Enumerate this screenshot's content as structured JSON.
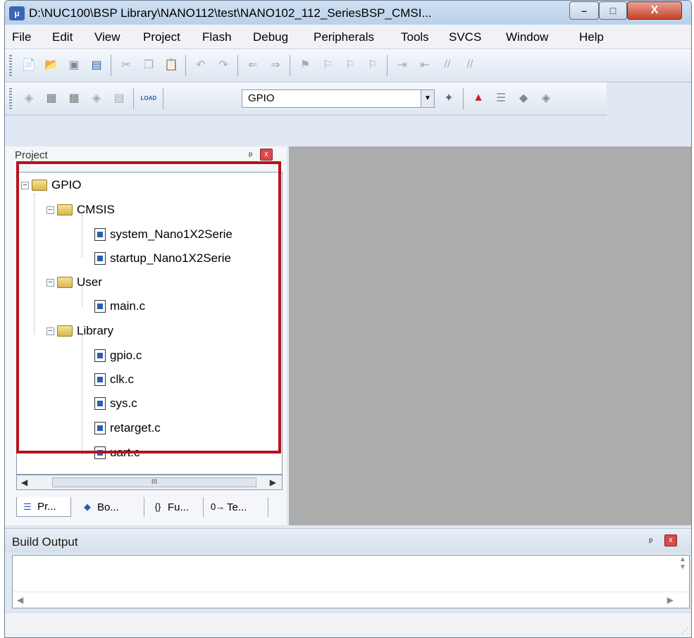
{
  "window": {
    "title": "D:\\NUC100\\BSP Library\\NANO112\\test\\NANO102_112_SeriesBSP_CMSI...",
    "app_icon_label": "μ",
    "controls": {
      "minimize": "–",
      "maximize": "□",
      "close": "X"
    }
  },
  "menubar": {
    "items": [
      "File",
      "Edit",
      "View",
      "Project",
      "Flash",
      "Debug",
      "Peripherals",
      "Tools",
      "SVCS",
      "Window",
      "Help"
    ]
  },
  "toolbar": {
    "target_selector": "GPIO",
    "load_label": "LOAD"
  },
  "project_pane": {
    "title": "Project",
    "pin": "ᵖ",
    "close": "x",
    "tree": {
      "root": "GPIO",
      "groups": [
        {
          "name": "CMSIS",
          "files": [
            "system_Nano1X2Serie",
            "startup_Nano1X2Serie"
          ]
        },
        {
          "name": "User",
          "files": [
            "main.c"
          ]
        },
        {
          "name": "Library",
          "files": [
            "gpio.c",
            "clk.c",
            "sys.c",
            "retarget.c",
            "uart.c"
          ]
        }
      ]
    },
    "scroll_thumb": "III",
    "tabs": [
      "Pr...",
      "Bo...",
      "Fu...",
      "Te..."
    ],
    "tab_icons": [
      "☰",
      "◆",
      "{}",
      "0→"
    ]
  },
  "build_output": {
    "title": "Build Output",
    "pin": "ᵖ",
    "close": "x"
  },
  "colors": {
    "highlight_border": "#b5121b",
    "editor_background": "#acacac"
  }
}
